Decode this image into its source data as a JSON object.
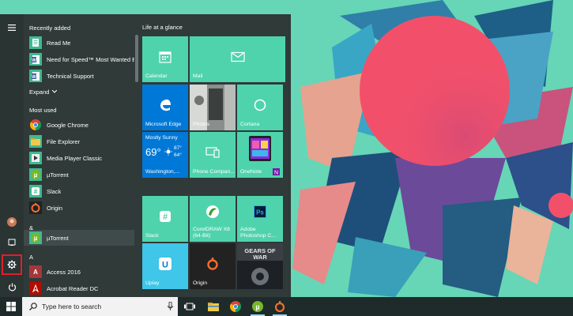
{
  "start_menu": {
    "sections": {
      "recently_added": "Recently added",
      "expand": "Expand",
      "most_used": "Most used",
      "ampersand": "&",
      "letter_a": "A"
    },
    "recent_apps": [
      {
        "label": "Read Me",
        "icon": "text-document-icon",
        "color": "#3fb98f"
      },
      {
        "label": "Need for Speed™ Most Wanted E...",
        "icon": "word-document-icon",
        "color": "#3fb98f"
      },
      {
        "label": "Technical Support",
        "icon": "word-document-icon",
        "color": "#3fb98f"
      }
    ],
    "most_used_apps": [
      {
        "label": "Google Chrome",
        "icon": "chrome-icon"
      },
      {
        "label": "File Explorer",
        "icon": "folder-icon"
      },
      {
        "label": "Media Player Classic",
        "icon": "media-player-icon"
      },
      {
        "label": "µTorrent",
        "icon": "utorrent-icon"
      },
      {
        "label": "Slack",
        "icon": "slack-icon"
      },
      {
        "label": "Origin",
        "icon": "origin-icon"
      }
    ],
    "amp_apps": [
      {
        "label": "µTorrent",
        "icon": "utorrent-icon"
      }
    ],
    "a_apps": [
      {
        "label": "Access 2016",
        "icon": "access-icon"
      },
      {
        "label": "Acrobat Reader DC",
        "icon": "acrobat-icon"
      }
    ]
  },
  "tiles": {
    "group_title": "Life at a glance",
    "calendar": "Calendar",
    "mail": "Mail",
    "edge": "Microsoft Edge",
    "photos": "Photos",
    "cortana": "Cortana",
    "weather": {
      "condition": "Mostly Sunny",
      "temp": "69°",
      "high": "87°",
      "low": "64°",
      "location": "Washington,..."
    },
    "phone": "Phone Compan...",
    "onenote": "OneNote",
    "slack": "Slack",
    "coreldraw": "CorelDRAW X8 (64-Bit)",
    "photoshop": "Adobe Photoshop C...",
    "uplay": "Uplay",
    "origin": "Origin",
    "gears": "GEARS OF WAR"
  },
  "taskbar": {
    "search_placeholder": "Type here to search"
  },
  "colors": {
    "tile": "#4fd3ad",
    "tile_blue": "#0078d7",
    "start_bg": "#2f3a39",
    "highlight": "#e0202a",
    "wallpaper": "#66d6b6"
  }
}
